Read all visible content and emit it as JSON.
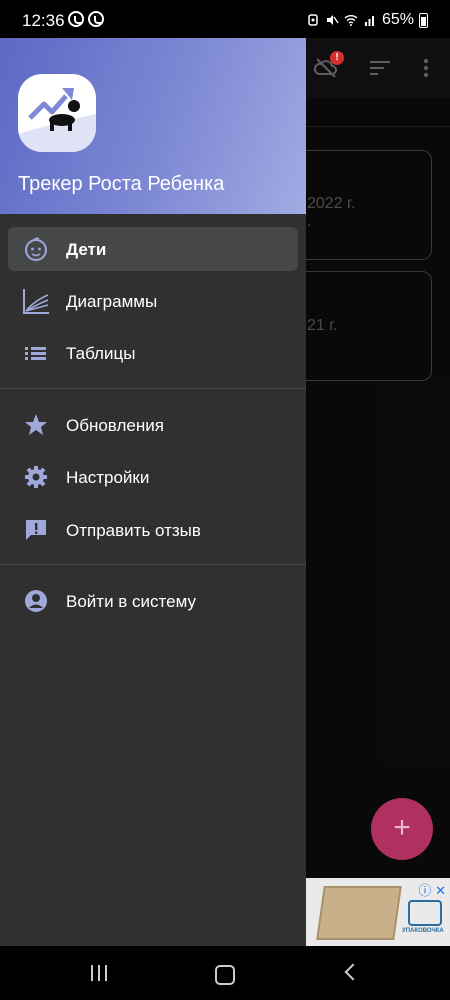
{
  "status_bar": {
    "time": "12:36",
    "battery": "65%"
  },
  "drawer": {
    "app_title": "Трекер Роста Ребенка",
    "items": [
      {
        "label": "Дети",
        "icon": "baby-face-icon",
        "active": true
      },
      {
        "label": "Диаграммы",
        "icon": "growth-chart-icon"
      },
      {
        "label": "Таблицы",
        "icon": "list-icon"
      },
      {
        "label": "Обновления",
        "icon": "star-icon"
      },
      {
        "label": "Настройки",
        "icon": "gear-icon"
      },
      {
        "label": "Отправить отзыв",
        "icon": "feedback-icon"
      },
      {
        "label": "Войти в систему",
        "icon": "account-circle-icon"
      }
    ]
  },
  "background": {
    "cards": [
      {
        "line1": "2022 г.",
        "line2": "."
      },
      {
        "line1": "21 г.",
        "line2": ""
      }
    ],
    "badge": "!",
    "fab_label": "+"
  },
  "ad": {
    "brand": "УПАКОВОЧКА"
  },
  "colors": {
    "accent": "#5c68c4",
    "drawer_bg": "#303030",
    "active_item": "#464748",
    "icon_tint": "#9fa8da",
    "fab": "#b03060"
  }
}
